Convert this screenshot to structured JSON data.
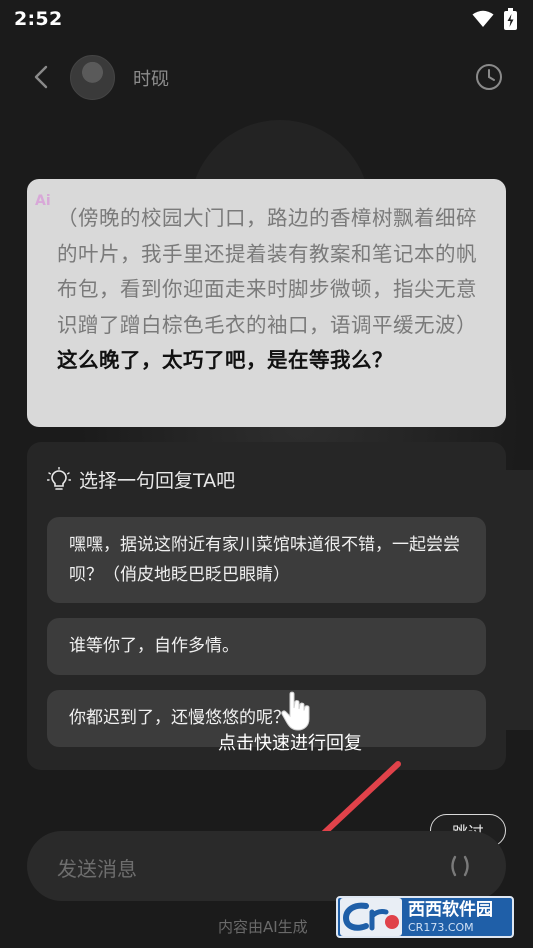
{
  "status_bar": {
    "time": "2:52"
  },
  "header": {
    "contact_name": "时砚"
  },
  "message": {
    "ai_badge": "Ai",
    "narration": "（傍晚的校园大门口，路边的香樟树飘着细碎的叶片，我手里还提着装有教案和笔记本的帆布包，看到你迎面走来时脚步微顿，指尖无意识蹭了蹭白棕色毛衣的袖口，语调平缓无波）",
    "speech": "这么晚了，太巧了吧，是在等我么？"
  },
  "reply_panel": {
    "title": "选择一句回复TA吧",
    "options": [
      "嘿嘿，据说这附近有家川菜馆味道很不错，一起尝尝呗？（俏皮地眨巴眨巴眼睛）",
      "谁等你了，自作多情。",
      "你都迟到了，还慢悠悠的呢？"
    ]
  },
  "hint": "点击快速进行回复",
  "skip_label": "跳过",
  "input": {
    "placeholder": "发送消息"
  },
  "footer_note": "内容由AI生成",
  "watermark": {
    "name": "西西软件园",
    "url": "CR173.COM"
  },
  "colors": {
    "bubble": "#d9d9d9",
    "panel": "#262626",
    "option": "#3c3c3c",
    "arrow": "#e0424a"
  }
}
